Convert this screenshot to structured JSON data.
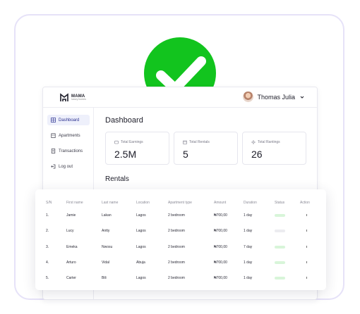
{
  "app": {
    "logo_name": "MAMA",
    "logo_tagline": "luxury homes"
  },
  "user": {
    "name": "Thomas Julia"
  },
  "sidebar": {
    "items": [
      {
        "label": "Dashboard",
        "icon": "grid-icon",
        "active": true
      },
      {
        "label": "Apartments",
        "icon": "building-icon",
        "active": false
      },
      {
        "label": "Transactions",
        "icon": "receipt-icon",
        "active": false
      },
      {
        "label": "Log out",
        "icon": "logout-icon",
        "active": false
      }
    ]
  },
  "page_title": "Dashboard",
  "stats": [
    {
      "label": "Total Earnings",
      "value": "2.5M",
      "icon": "wallet-icon"
    },
    {
      "label": "Total Rentals",
      "value": "5",
      "icon": "calendar-icon"
    },
    {
      "label": "Total Rantings",
      "value": "26",
      "icon": "sparkle-icon"
    }
  ],
  "rentals_title": "Rentals",
  "table": {
    "headers": [
      "S/N",
      "First name",
      "Last name",
      "Location",
      "Apartment type",
      "Amount",
      "Duration",
      "Status",
      "Action"
    ],
    "rows": [
      [
        "1.",
        "Jamie",
        "Lakan",
        "Lagos",
        "2 bedroom",
        "₦700,00",
        "1 day",
        "active",
        ":"
      ],
      [
        "2.",
        "Lucy",
        "Antty",
        "Lagos",
        "2 bedroom",
        "₦700,00",
        "1 day",
        "inactive",
        ":"
      ],
      [
        "3.",
        "Emeka",
        "Nwosu",
        "Lagos",
        "2 bedroom",
        "₦700,00",
        "7 day",
        "active",
        ":"
      ],
      [
        "4.",
        "Arturo",
        "Vidal",
        "Abuja",
        "2 bedroom",
        "₦700,00",
        "1 day",
        "active",
        ":"
      ],
      [
        "5.",
        "Carter",
        "Bili",
        "Lagos",
        "2 bedroom",
        "₦700,00",
        "1 day",
        "active",
        ":"
      ]
    ]
  },
  "colors": {
    "success": "#12c41e",
    "active_nav_bg": "#eef0fb",
    "status_active": "#d8f5d9",
    "status_inactive": "#ececf0"
  }
}
